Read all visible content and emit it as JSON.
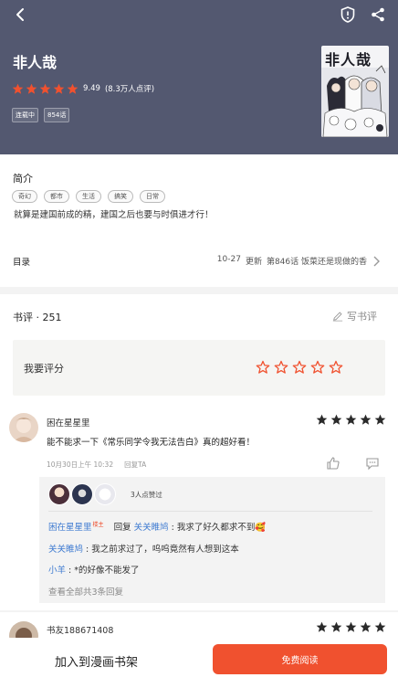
{
  "header": {
    "title": "非人哉",
    "score": "9.49",
    "rating_count": "(8.3万人点评)",
    "badges": [
      "连载中",
      "854话"
    ],
    "cover_title": "非人哉",
    "star_color": "#f0512f",
    "bg_color": "#535870"
  },
  "intro": {
    "title": "简介",
    "tags": [
      "奇幻",
      "都市",
      "生活",
      "搞笑",
      "日常"
    ],
    "description": "就算是建国前成的精，建国之后也要与时俱进才行！"
  },
  "toc": {
    "label": "目录",
    "date": "10-27",
    "update_label": "更新",
    "latest": "第846话 饭菜还是现做的香"
  },
  "reviews": {
    "header": "书评 · 251",
    "write_label": "写书评",
    "rate_label": "我要评分",
    "items": [
      {
        "user": "困在星星里",
        "stars": 5,
        "text": "能不能求一下《常乐同学令我无法告白》真的超好看！",
        "time": "10月30日上午 10:32",
        "reply_label": "回复TA",
        "likers_label": "3人点赞过",
        "replies": [
          {
            "name": "困在星星里",
            "host": "楼主",
            "verb": "回复",
            "target": "关关睢鸠",
            "text": "我求了好久都求不到🥰"
          },
          {
            "name": "关关睢鸠",
            "text": "我之前求过了，呜呜竟然有人想到这本"
          },
          {
            "name": "小羊",
            "text": "*的好像不能发了"
          }
        ],
        "view_all": "查看全部共3条回复"
      },
      {
        "user": "书友188671408",
        "stars": 5
      }
    ]
  },
  "bottom": {
    "shelf_label": "加入到漫画书架",
    "read_label": "免费阅读",
    "accent": "#f0512f"
  }
}
